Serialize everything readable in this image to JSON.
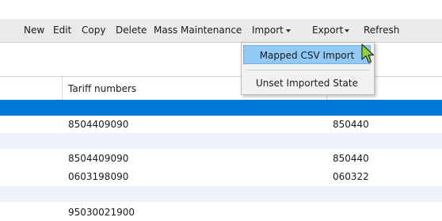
{
  "toolbar": {
    "items": [
      {
        "label": "New"
      },
      {
        "label": "Edit"
      },
      {
        "label": "Copy"
      },
      {
        "label": "Delete"
      },
      {
        "label": "Mass Maintenance"
      },
      {
        "label": "Import"
      },
      {
        "label": "Export"
      },
      {
        "label": "Refresh"
      }
    ]
  },
  "grid": {
    "header": {
      "tariff_label": "Tariff numbers"
    },
    "rows": [
      {
        "tariff": "",
        "code": "",
        "state": "selected"
      },
      {
        "tariff": "8504409090",
        "code": "850440"
      },
      {
        "tariff": "",
        "code": ""
      },
      {
        "tariff": "8504409090",
        "code": "850440"
      },
      {
        "tariff": "0603198090",
        "code": "060322"
      },
      {
        "tariff": "",
        "code": ""
      },
      {
        "tariff": "95030021900",
        "code": ""
      }
    ]
  },
  "import_menu": {
    "items": [
      {
        "label": "Mapped CSV Import",
        "state": "hovered"
      },
      {
        "label": "Unset Imported State"
      }
    ]
  },
  "colors": {
    "selection": "#0078d7",
    "menu_highlight": "#91c9f7",
    "alt_row": "#eef2f9"
  },
  "cursor": {
    "icon": "green-arrow-cursor-icon"
  }
}
